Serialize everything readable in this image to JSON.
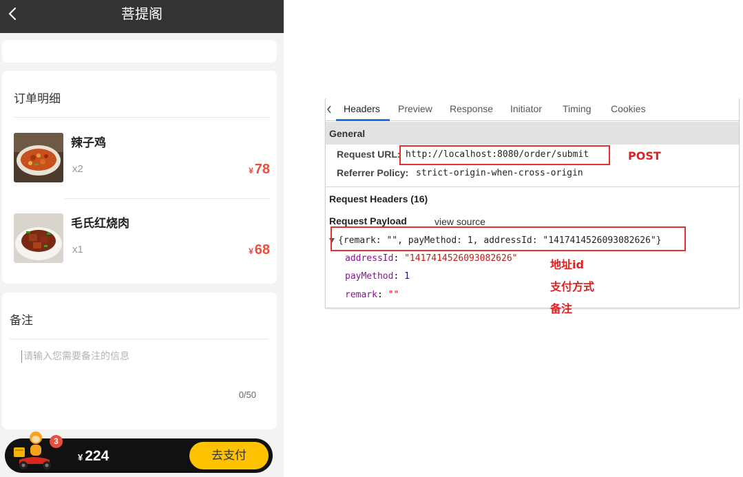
{
  "app": {
    "title": "菩提阁",
    "order_section_title": "订单明细",
    "items": [
      {
        "name": "辣子鸡",
        "qty": "x2",
        "currency": "¥",
        "price": "78"
      },
      {
        "name": "毛氏红烧肉",
        "qty": "x1",
        "currency": "¥",
        "price": "68"
      }
    ],
    "remark_section_title": "备注",
    "remark_placeholder": "请输入您需要备注的信息",
    "remark_count": "0/50",
    "cart_badge": "3",
    "total_currency": "¥",
    "total": "224",
    "pay_button": "去支付"
  },
  "devtools": {
    "tabs": [
      "Headers",
      "Preview",
      "Response",
      "Initiator",
      "Timing",
      "Cookies"
    ],
    "active_tab": "Headers",
    "general_label": "General",
    "request_url_label": "Request URL:",
    "request_url": "http://localhost:8080/order/submit",
    "referrer_policy_label": "Referrer Policy:",
    "referrer_policy": "strict-origin-when-cross-origin",
    "request_headers_label": "Request Headers (16)",
    "request_payload_label": "Request Payload",
    "view_source_label": "view source",
    "payload_summary": "{remark: \"\", payMethod: 1, addressId: \"1417414526093082626\"}",
    "payload_props": [
      {
        "key": "addressId",
        "value": "\"1417414526093082626\"",
        "kind": "string"
      },
      {
        "key": "payMethod",
        "value": "1",
        "kind": "number"
      },
      {
        "key": "remark",
        "value": "\"\"",
        "kind": "string"
      }
    ]
  },
  "annotations": {
    "method": "POST",
    "address_id": "地址id",
    "pay_method": "支付方式",
    "remark": "备注"
  },
  "colors": {
    "topbar": "#333333",
    "price_red": "#e94e3c",
    "pay_yellow": "#ffc200",
    "annotation_red": "#e02020",
    "tab_accent": "#1a73e8"
  }
}
